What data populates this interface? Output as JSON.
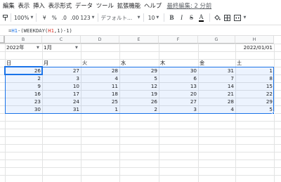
{
  "menu": {
    "items": [
      "編集",
      "表示",
      "挿入",
      "表示形式",
      "データ",
      "ツール",
      "拡張機能",
      "ヘルプ"
    ],
    "last_edit": "最終編集: 2 分前"
  },
  "toolbar": {
    "zoom": "100%",
    "currency": "¥",
    "percent": "%",
    "dec_decrease": ".0",
    "dec_increase": ".00",
    "more_formats": "123",
    "font": "デフォルト...",
    "font_size": "10",
    "bold": "B",
    "italic": "I",
    "strike": "S",
    "text_color": "A"
  },
  "formula": {
    "prefix": "=",
    "part1": "H1",
    "part2": "-(WEEKDAY(",
    "part3": "H1",
    "part4": ",1)-1)"
  },
  "columns": [
    "B",
    "C",
    "D",
    "E",
    "F",
    "G",
    "H"
  ],
  "sheet": {
    "year": "2022年",
    "month": "1月",
    "date": "2022/01/01",
    "weekdays": [
      "日",
      "月",
      "火",
      "水",
      "木",
      "金",
      "土"
    ],
    "weeks": [
      [
        "26",
        "27",
        "28",
        "29",
        "30",
        "31",
        "1"
      ],
      [
        "2",
        "3",
        "4",
        "5",
        "6",
        "7",
        "8"
      ],
      [
        "9",
        "10",
        "11",
        "12",
        "13",
        "14",
        "15"
      ],
      [
        "16",
        "17",
        "18",
        "19",
        "20",
        "21",
        "22"
      ],
      [
        "23",
        "24",
        "25",
        "26",
        "27",
        "28",
        "29"
      ],
      [
        "30",
        "31",
        "1",
        "2",
        "3",
        "4",
        "5"
      ]
    ]
  },
  "colors": {
    "selection_border": "#1a73e8",
    "selection_fill": "#eaf1fd"
  }
}
